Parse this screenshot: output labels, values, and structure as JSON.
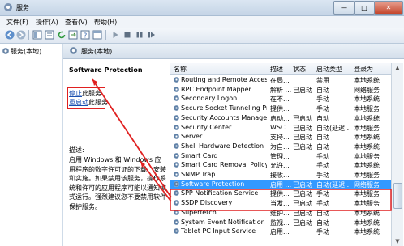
{
  "window": {
    "title": "服务",
    "buttons": {
      "minimize": "—",
      "maximize": "□",
      "close": "✕"
    }
  },
  "menu": [
    "文件(F)",
    "操作(A)",
    "查看(V)",
    "帮助(H)"
  ],
  "tree": {
    "root": "服务(本地)"
  },
  "panel": {
    "header": "服务(本地)"
  },
  "description": {
    "service_name": "Software Protection",
    "stop_link": "停止",
    "stop_suffix": "此服务",
    "restart_link": "重启动",
    "restart_suffix": "此服务",
    "label": "描述:",
    "text": "启用 Windows 和 Windows 应用程序的数字许可证的下载、安装和实施。如果禁用该服务，操作系统和许可的应用程序可能以通知模式运行。强烈建议您不要禁用软件保护服务。"
  },
  "columns": [
    "名称",
    "描述",
    "状态",
    "启动类型",
    "登录为"
  ],
  "rows": [
    {
      "name": "Routing and Remote Access",
      "desc": "在局...",
      "status": "",
      "startup": "禁用",
      "logon": "本地系统"
    },
    {
      "name": "RPC Endpoint Mapper",
      "desc": "解析 ...",
      "status": "已启动",
      "startup": "自动",
      "logon": "网络服务"
    },
    {
      "name": "Secondary Logon",
      "desc": "在不...",
      "status": "",
      "startup": "手动",
      "logon": "本地系统"
    },
    {
      "name": "Secure Socket Tunneling Pr...",
      "desc": "提供...",
      "status": "",
      "startup": "手动",
      "logon": "本地服务"
    },
    {
      "name": "Security Accounts Manager",
      "desc": "启动...",
      "status": "已启动",
      "startup": "自动",
      "logon": "本地系统"
    },
    {
      "name": "Security Center",
      "desc": "WSC...",
      "status": "已启动",
      "startup": "自动(延迟...",
      "logon": "本地服务"
    },
    {
      "name": "Server",
      "desc": "支持...",
      "status": "已启动",
      "startup": "自动",
      "logon": "本地系统"
    },
    {
      "name": "Shell Hardware Detection",
      "desc": "为自...",
      "status": "已启动",
      "startup": "自动",
      "logon": "本地系统"
    },
    {
      "name": "Smart Card",
      "desc": "管理...",
      "status": "",
      "startup": "手动",
      "logon": "本地服务"
    },
    {
      "name": "Smart Card Removal Policy",
      "desc": "允许...",
      "status": "",
      "startup": "手动",
      "logon": "本地系统"
    },
    {
      "name": "SNMP Trap",
      "desc": "接收...",
      "status": "",
      "startup": "手动",
      "logon": "本地服务"
    },
    {
      "name": "Software Protection",
      "desc": "启用 ...",
      "status": "已启动",
      "startup": "自动(延迟...",
      "logon": "网络服务"
    },
    {
      "name": "SPP Notification Service",
      "desc": "提供...",
      "status": "已启动",
      "startup": "手动",
      "logon": "本地服务"
    },
    {
      "name": "SSDP Discovery",
      "desc": "当发...",
      "status": "已启动",
      "startup": "手动",
      "logon": "本地服务"
    },
    {
      "name": "Superfetch",
      "desc": "维护...",
      "status": "已启动",
      "startup": "自动",
      "logon": "本地系统"
    },
    {
      "name": "System Event Notification S...",
      "desc": "监视...",
      "status": "已启动",
      "startup": "自动",
      "logon": "本地系统"
    },
    {
      "name": "Tablet PC Input Service",
      "desc": "启用...",
      "status": "",
      "startup": "手动",
      "logon": "本地系统"
    }
  ],
  "selected_row": "Software Protection",
  "colors": {
    "selection": "#3399ff",
    "annotation": "#e02020",
    "link": "#1a4fb0"
  }
}
